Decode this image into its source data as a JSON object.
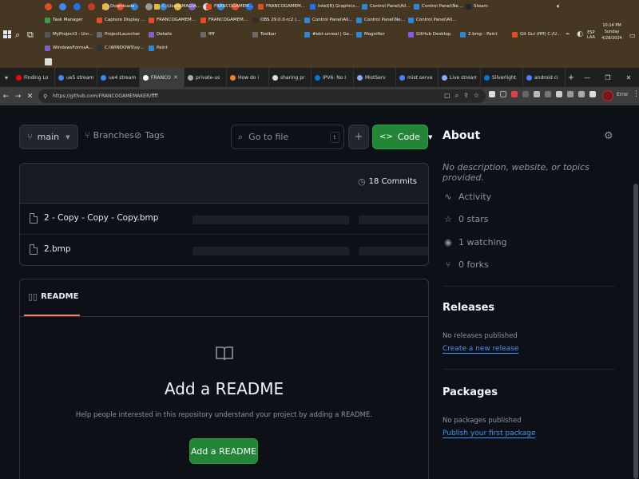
{
  "taskbar": {
    "row1": [
      {
        "label": "Downloads",
        "color": "#e8b73c"
      },
      {
        "label": "C:\\Users\\MAGIAN\\One...",
        "color": "#e8b73c"
      },
      {
        "label": "FRANCOGAMEMAKE...",
        "color": "#e34c26"
      },
      {
        "label": "FRANCOGAMEMAKE...",
        "color": "#e34c26"
      },
      {
        "label": "Intel(R) Graphics Co...",
        "color": "#1a73e8"
      },
      {
        "label": "Control Panel\\All Cont...",
        "color": "#2b88d8"
      },
      {
        "label": "Control Panel\\Networ...",
        "color": "#2b88d8"
      },
      {
        "label": "Steam",
        "color": "#1b2838"
      }
    ],
    "row2": [
      {
        "label": "Task Manager",
        "color": "#3e9b49"
      },
      {
        "label": "Capture Display BMP...",
        "color": "#e34c26"
      },
      {
        "label": "FRANCOGAMEMAKE...",
        "color": "#e34c26"
      },
      {
        "label": "FRANCOGAMEMAKE...",
        "color": "#e34c26"
      },
      {
        "label": "OBS 29.0.0-rc2 (64-...",
        "color": "#302e31"
      },
      {
        "label": "Control Panel\\All Cont...",
        "color": "#2b88d8"
      },
      {
        "label": "Control Panel\\Networ...",
        "color": "#2b88d8"
      },
      {
        "label": "Control Panel\\All Cont...",
        "color": "#2b88d8"
      }
    ],
    "row3": [
      {
        "label": "MyProject3 - Unreal...",
        "color": "#555555"
      },
      {
        "label": "ProjectLauncher",
        "color": "#6a6a6a"
      },
      {
        "label": "Details",
        "color": "#7b61c9"
      },
      {
        "label": "ffff",
        "color": "#6a6a6a"
      },
      {
        "label": "Toolbar",
        "color": "#6a6a6a"
      },
      {
        "label": "#ebt-unreal | Gemin...",
        "color": "#2b88d8"
      },
      {
        "label": "Magnifier",
        "color": "#2b88d8"
      },
      {
        "label": "GitHub Desktop",
        "color": "#8957e5"
      },
      {
        "label": "2.bmp - Paint",
        "color": "#2b88d8"
      },
      {
        "label": "Git Gui (ffff) C:/Use...",
        "color": "#e34c26"
      }
    ],
    "row4": [
      {
        "label": "WindowsFormsApp3 -...",
        "color": "#7b61c9"
      },
      {
        "label": "C:\\WINDOWS\\system...",
        "color": "#333333"
      },
      {
        "label": "Paint",
        "color": "#2b88d8"
      }
    ],
    "tray": {
      "ime_line1": "ESP",
      "ime_line2": "LAA",
      "time": "10:14 PM",
      "day": "Sunday",
      "date": "4/28/2024"
    }
  },
  "browser": {
    "tabs": [
      {
        "title": "Finding Lo",
        "color": "#ff0000"
      },
      {
        "title": "ue5 stream",
        "color": "#4285f4"
      },
      {
        "title": "ue4 stream",
        "color": "#4285f4"
      },
      {
        "title": "FRANCO",
        "color": "#ffffff",
        "active": true
      },
      {
        "title": "private-us",
        "color": "#aaaaaa"
      },
      {
        "title": "How do i",
        "color": "#f48024"
      },
      {
        "title": "sharing pr",
        "color": "#dddddd"
      },
      {
        "title": "IPV6: No I",
        "color": "#0078d4"
      },
      {
        "title": "MistServ",
        "color": "#88aaff"
      },
      {
        "title": "mist serve",
        "color": "#4285f4"
      },
      {
        "title": "Live stream",
        "color": "#88aaff"
      },
      {
        "title": "Silverlight",
        "color": "#0078d4"
      },
      {
        "title": "android ci",
        "color": "#4285f4"
      }
    ],
    "url": "https://github.com/FRANCOGAMEMAKER/ffff",
    "error_label": "Error"
  },
  "repo": {
    "branch": "main",
    "branches_label": "Branches",
    "tags_label": "Tags",
    "go_to_file_placeholder": "Go to file",
    "go_to_file_key": "t",
    "add_label": "+",
    "code_label": "Code",
    "commits_label": "18 Commits",
    "files": [
      {
        "name": "2 - Copy - Copy - Copy.bmp"
      },
      {
        "name": "2.bmp"
      }
    ],
    "readme": {
      "tab_label": "README",
      "title": "Add a README",
      "subtitle": "Help people interested in this repository understand your project by adding a README.",
      "button": "Add a README"
    }
  },
  "sidebar": {
    "about_title": "About",
    "description": "No description, website, or topics provided.",
    "activity": "Activity",
    "stars": "0 stars",
    "watching": "1 watching",
    "forks": "0 forks",
    "releases_title": "Releases",
    "releases_note": "No releases published",
    "releases_link": "Create a new release",
    "packages_title": "Packages",
    "packages_note": "No packages published",
    "packages_link": "Publish your first package"
  }
}
